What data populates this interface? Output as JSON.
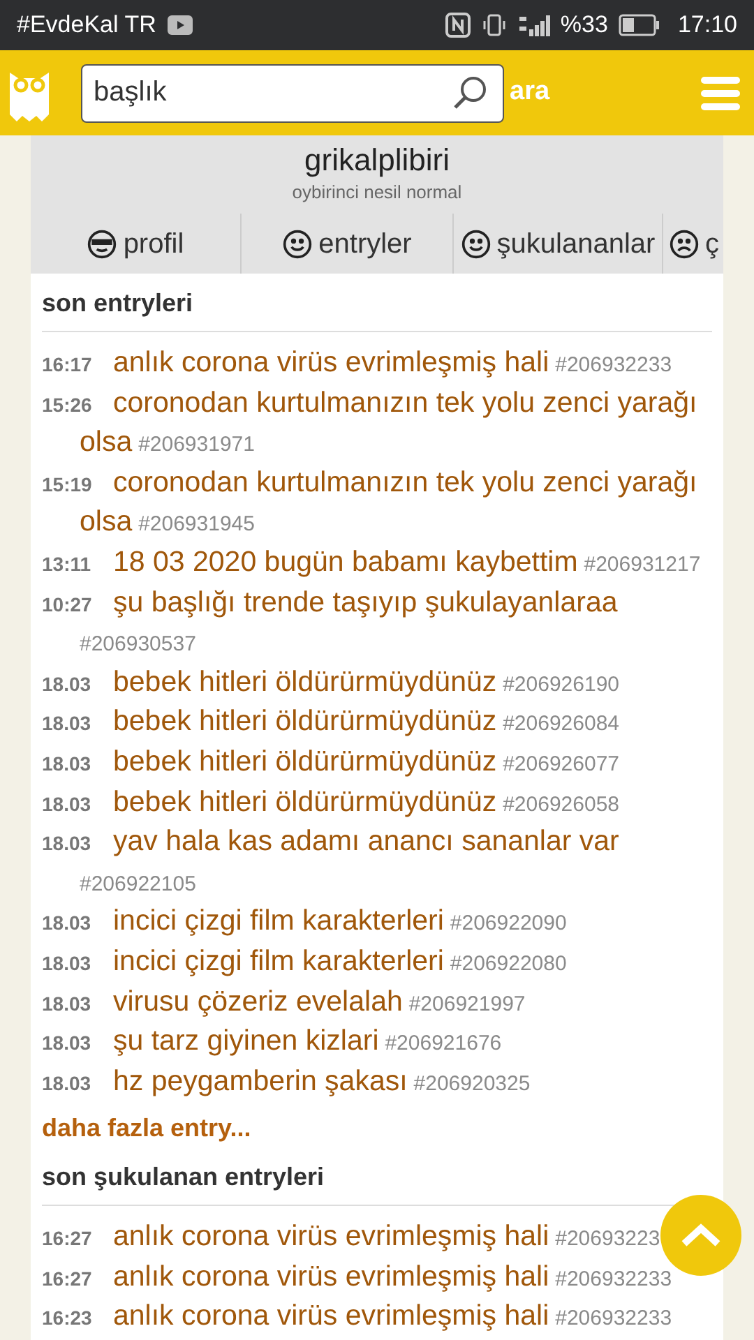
{
  "status_bar": {
    "left_text": "#EvdeKal TR",
    "battery": "%33",
    "time": "17:10"
  },
  "header": {
    "search": {
      "value": "başlık"
    },
    "search_button": "ara"
  },
  "profile": {
    "name": "grikalplibiri",
    "subtitle": "oybirinci nesil normal"
  },
  "tabs": [
    {
      "label": "profil",
      "kind": "cool",
      "selected": false
    },
    {
      "label": "entryler",
      "kind": "smile",
      "selected": false
    },
    {
      "label": "şukulananlar",
      "kind": "smile",
      "selected": false
    },
    {
      "label": "ç",
      "kind": "sad",
      "selected": false
    }
  ],
  "sections": [
    {
      "title": "son entryleri",
      "entries": [
        {
          "time": "16:17",
          "title": "anlık corona virüs evrimleşmiş hali",
          "id": "#206932233"
        },
        {
          "time": "15:26",
          "title": "coronodan kurtulmanızın tek yolu zenci yarağı olsa",
          "id": "#206931971"
        },
        {
          "time": "15:19",
          "title": "coronodan kurtulmanızın tek yolu zenci yarağı olsa",
          "id": "#206931945"
        },
        {
          "time": "13:11",
          "title": "18 03 2020 bugün babamı kaybettim",
          "id": "#206931217"
        },
        {
          "time": "10:27",
          "title": "şu başlığı trende taşıyıp şukulayanlaraa",
          "id": "#206930537"
        },
        {
          "time": "18.03",
          "title": "bebek hitleri öldürürmüydünüz",
          "id": "#206926190"
        },
        {
          "time": "18.03",
          "title": "bebek hitleri öldürürmüydünüz",
          "id": "#206926084"
        },
        {
          "time": "18.03",
          "title": "bebek hitleri öldürürmüydünüz",
          "id": "#206926077"
        },
        {
          "time": "18.03",
          "title": "bebek hitleri öldürürmüydünüz",
          "id": "#206926058"
        },
        {
          "time": "18.03",
          "title": "yav hala kas adamı anancı sananlar var",
          "id": "#206922105"
        },
        {
          "time": "18.03",
          "title": "incici çizgi film karakterleri",
          "id": "#206922090"
        },
        {
          "time": "18.03",
          "title": "incici çizgi film karakterleri",
          "id": "#206922080"
        },
        {
          "time": "18.03",
          "title": "virusu çözeriz evelalah",
          "id": "#206921997"
        },
        {
          "time": "18.03",
          "title": "şu tarz giyinen kizlari",
          "id": "#206921676"
        },
        {
          "time": "18.03",
          "title": "hz peygamberin şakası",
          "id": "#206920325"
        }
      ],
      "more": "daha fazla entry..."
    },
    {
      "title": "son şukulanan entryleri",
      "entries": [
        {
          "time": "16:27",
          "title": "anlık corona virüs evrimleşmiş hali",
          "id": "#20693223"
        },
        {
          "time": "16:27",
          "title": "anlık corona virüs evrimleşmiş hali",
          "id": "#206932233"
        },
        {
          "time": "16:23",
          "title": "anlık corona virüs evrimleşmiş hali",
          "id": "#206932233"
        }
      ]
    }
  ]
}
